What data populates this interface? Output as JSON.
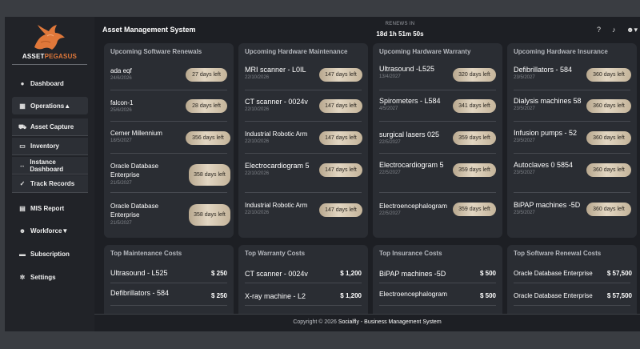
{
  "app": {
    "title": "Asset Management System",
    "renews_label": "RENEWS IN",
    "renews_time": "18d 1h 51m 50s",
    "logo_part1": "ASSET",
    "logo_part2": "PEGASUS"
  },
  "sidebar": {
    "items": [
      {
        "label": "Dashboard",
        "icon": "dashboard-icon"
      },
      {
        "label": "Operations▲",
        "icon": "operations-icon"
      },
      {
        "label": "Asset Capture",
        "icon": "cart-icon"
      },
      {
        "label": "Inventory",
        "icon": "inventory-icon"
      },
      {
        "label": "Instance Dashboard",
        "icon": "instance-icon"
      },
      {
        "label": "Track Records",
        "icon": "check-icon"
      },
      {
        "label": "MIS Report",
        "icon": "report-icon"
      },
      {
        "label": "Workforce▼",
        "icon": "workforce-icon"
      },
      {
        "label": "Subscription",
        "icon": "subscription-icon"
      },
      {
        "label": "Settings",
        "icon": "gear-icon"
      }
    ]
  },
  "panels": {
    "software": {
      "title": "Upcoming Software Renewals",
      "items": [
        {
          "name": "ada eqf",
          "date": "24/6/2026",
          "days": "27 days left"
        },
        {
          "name": "falcon-1",
          "date": "25/6/2026",
          "days": "28 days left"
        },
        {
          "name": "Cerner Millennium",
          "date": "18/5/2027",
          "days": "356 days left"
        },
        {
          "name": "Oracle Database Enterprise",
          "date": "21/5/2027",
          "days": "358 days left"
        },
        {
          "name": "Oracle Database Enterprise",
          "date": "21/5/2027",
          "days": "358 days left"
        }
      ]
    },
    "maintenance": {
      "title": "Upcoming Hardware Maintenance",
      "items": [
        {
          "name": "MRI scanner - L0IL",
          "date": "22/10/2026",
          "days": "147 days left"
        },
        {
          "name": "CT scanner - 0024v",
          "date": "22/10/2026",
          "days": "147 days left"
        },
        {
          "name": "Industrial Robotic Arm",
          "date": "22/10/2026",
          "days": "147 days left"
        },
        {
          "name": "Electrocardiogram 5",
          "date": "22/10/2026",
          "days": "147 days left"
        },
        {
          "name": "Industrial Robotic Arm",
          "date": "22/10/2026",
          "days": "147 days left"
        }
      ]
    },
    "warranty": {
      "title": "Upcoming Hardware Warranty",
      "items": [
        {
          "name": "Ultrasound -L525",
          "date": "13/4/2027",
          "days": "320 days left"
        },
        {
          "name": "Spirometers - L584",
          "date": "4/5/2027",
          "days": "341 days left"
        },
        {
          "name": "surgical lasers 025",
          "date": "22/5/2027",
          "days": "359 days left"
        },
        {
          "name": "Electrocardiogram 5",
          "date": "22/5/2027",
          "days": "359 days left"
        },
        {
          "name": "Electroencephalogram",
          "date": "22/5/2027",
          "days": "359 days left"
        }
      ]
    },
    "insurance": {
      "title": "Upcoming Hardware Insurance",
      "items": [
        {
          "name": "Defibrillators - 584",
          "date": "23/5/2027",
          "days": "360 days left"
        },
        {
          "name": "Dialysis machines 58",
          "date": "23/5/2027",
          "days": "360 days left"
        },
        {
          "name": "Infusion pumps - 52",
          "date": "23/5/2027",
          "days": "360 days left"
        },
        {
          "name": "Autoclaves 0 5854",
          "date": "23/5/2027",
          "days": "360 days left"
        },
        {
          "name": "BiPAP machines -5D",
          "date": "23/5/2027",
          "days": "360 days left"
        }
      ]
    }
  },
  "costs": {
    "maintenance": {
      "title": "Top Maintenance Costs",
      "items": [
        {
          "name": "Ultrasound - L525",
          "value": "$ 250"
        },
        {
          "name": "Defibrillators - 584",
          "value": "$ 250"
        }
      ]
    },
    "warranty": {
      "title": "Top Warranty Costs",
      "items": [
        {
          "name": "CT scanner - 0024v",
          "value": "$ 1,200"
        },
        {
          "name": "X-ray machine - L2",
          "value": "$ 1,200"
        }
      ]
    },
    "insurance": {
      "title": "Top Insurance Costs",
      "items": [
        {
          "name": "BiPAP machines -5D",
          "value": "$ 500"
        },
        {
          "name": "Electroencephalogram",
          "value": "$ 500"
        }
      ]
    },
    "software": {
      "title": "Top Software Renewal Costs",
      "items": [
        {
          "name": "Oracle Database Enterprise",
          "value": "$ 57,500"
        },
        {
          "name": "Oracle Database Enterprise",
          "value": "$ 57,500"
        }
      ]
    }
  },
  "footer": {
    "copyright": "Copyright © 2026",
    "brand": "Socialfly - Business Management System"
  },
  "colors": {
    "background": "#1d1f24",
    "panel": "#2a2d33",
    "sidebar": "#212328",
    "accent_orange": "#e0783a",
    "pill_gold": "#d8cab2"
  },
  "top_icons": [
    "help-icon",
    "bell-icon",
    "user-icon"
  ]
}
